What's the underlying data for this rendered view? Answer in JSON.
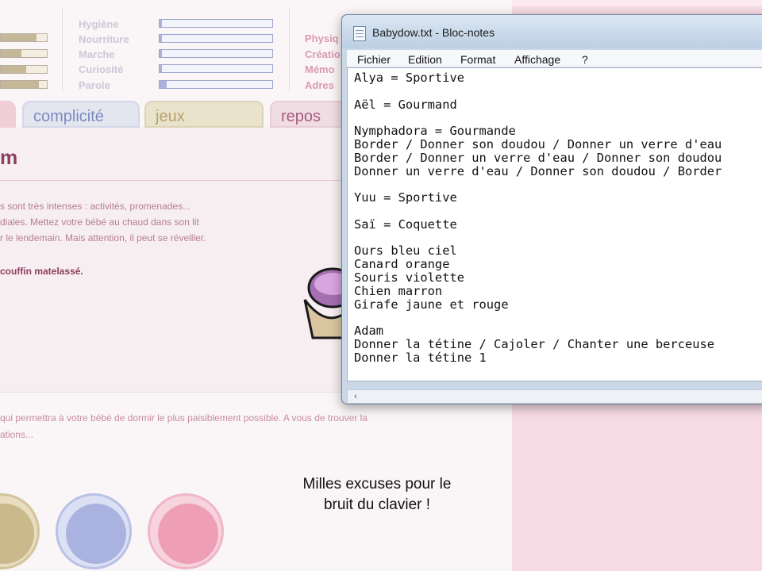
{
  "stats": {
    "left_bars": [
      0.78,
      0.45,
      0.55,
      0.82
    ],
    "items": [
      {
        "label": "Hygiène",
        "level": 0.02
      },
      {
        "label": "Nourriture",
        "level": 0.02
      },
      {
        "label": "Marche",
        "level": 0.02
      },
      {
        "label": "Curiosité",
        "level": 0.02
      },
      {
        "label": "Parole",
        "level": 0.06
      }
    ],
    "right_labels": [
      "Physiq",
      "Créatio",
      "Mémo",
      "Adres"
    ]
  },
  "tabs": {
    "complicite": "complicité",
    "jeux": "jeux",
    "repos": "repos"
  },
  "content": {
    "title": "m",
    "lines": [
      "s sont très intenses : activités, promenades...",
      "diales. Mettez votre bébé au chaud dans son lit",
      "r le lendemain. Mais attention, il peut se réveiller."
    ],
    "bold_item": "couffin matelassé.",
    "lower_lines": [
      "qui permettra à votre bébé de dormir le plus paisiblement possible. A vous de trouver la",
      "ations..."
    ]
  },
  "caption": {
    "line1": "Milles excuses pour le",
    "line2": "bruit du clavier !"
  },
  "notepad": {
    "title": "Babydow.txt - Bloc-notes",
    "menu": [
      "Fichier",
      "Edition",
      "Format",
      "Affichage",
      "?"
    ],
    "lines": [
      "Alya = Sportive",
      "",
      "Aël = Gourmand",
      "",
      "Nymphadora = Gourmande",
      "Border / Donner son doudou / Donner un verre d'eau",
      "Border / Donner un verre d'eau / Donner son doudou",
      "Donner un verre d'eau / Donner son doudou / Border",
      "",
      "Yuu = Sportive",
      "",
      "Saï = Coquette",
      "",
      "Ours bleu ciel",
      "Canard orange",
      "Souris violette",
      "Chien marron",
      "Girafe jaune et rouge",
      "",
      "Adam",
      "Donner la tétine / Cajoler / Chanter une berceuse",
      "Donner la tétine 1"
    ],
    "scroll_left_glyph": "‹"
  },
  "colors": {
    "accent_pink": "#f6dbe4",
    "tab_blue": "#7b8bc0",
    "tab_gold": "#b7a26a",
    "tab_rose": "#a85b7c"
  }
}
